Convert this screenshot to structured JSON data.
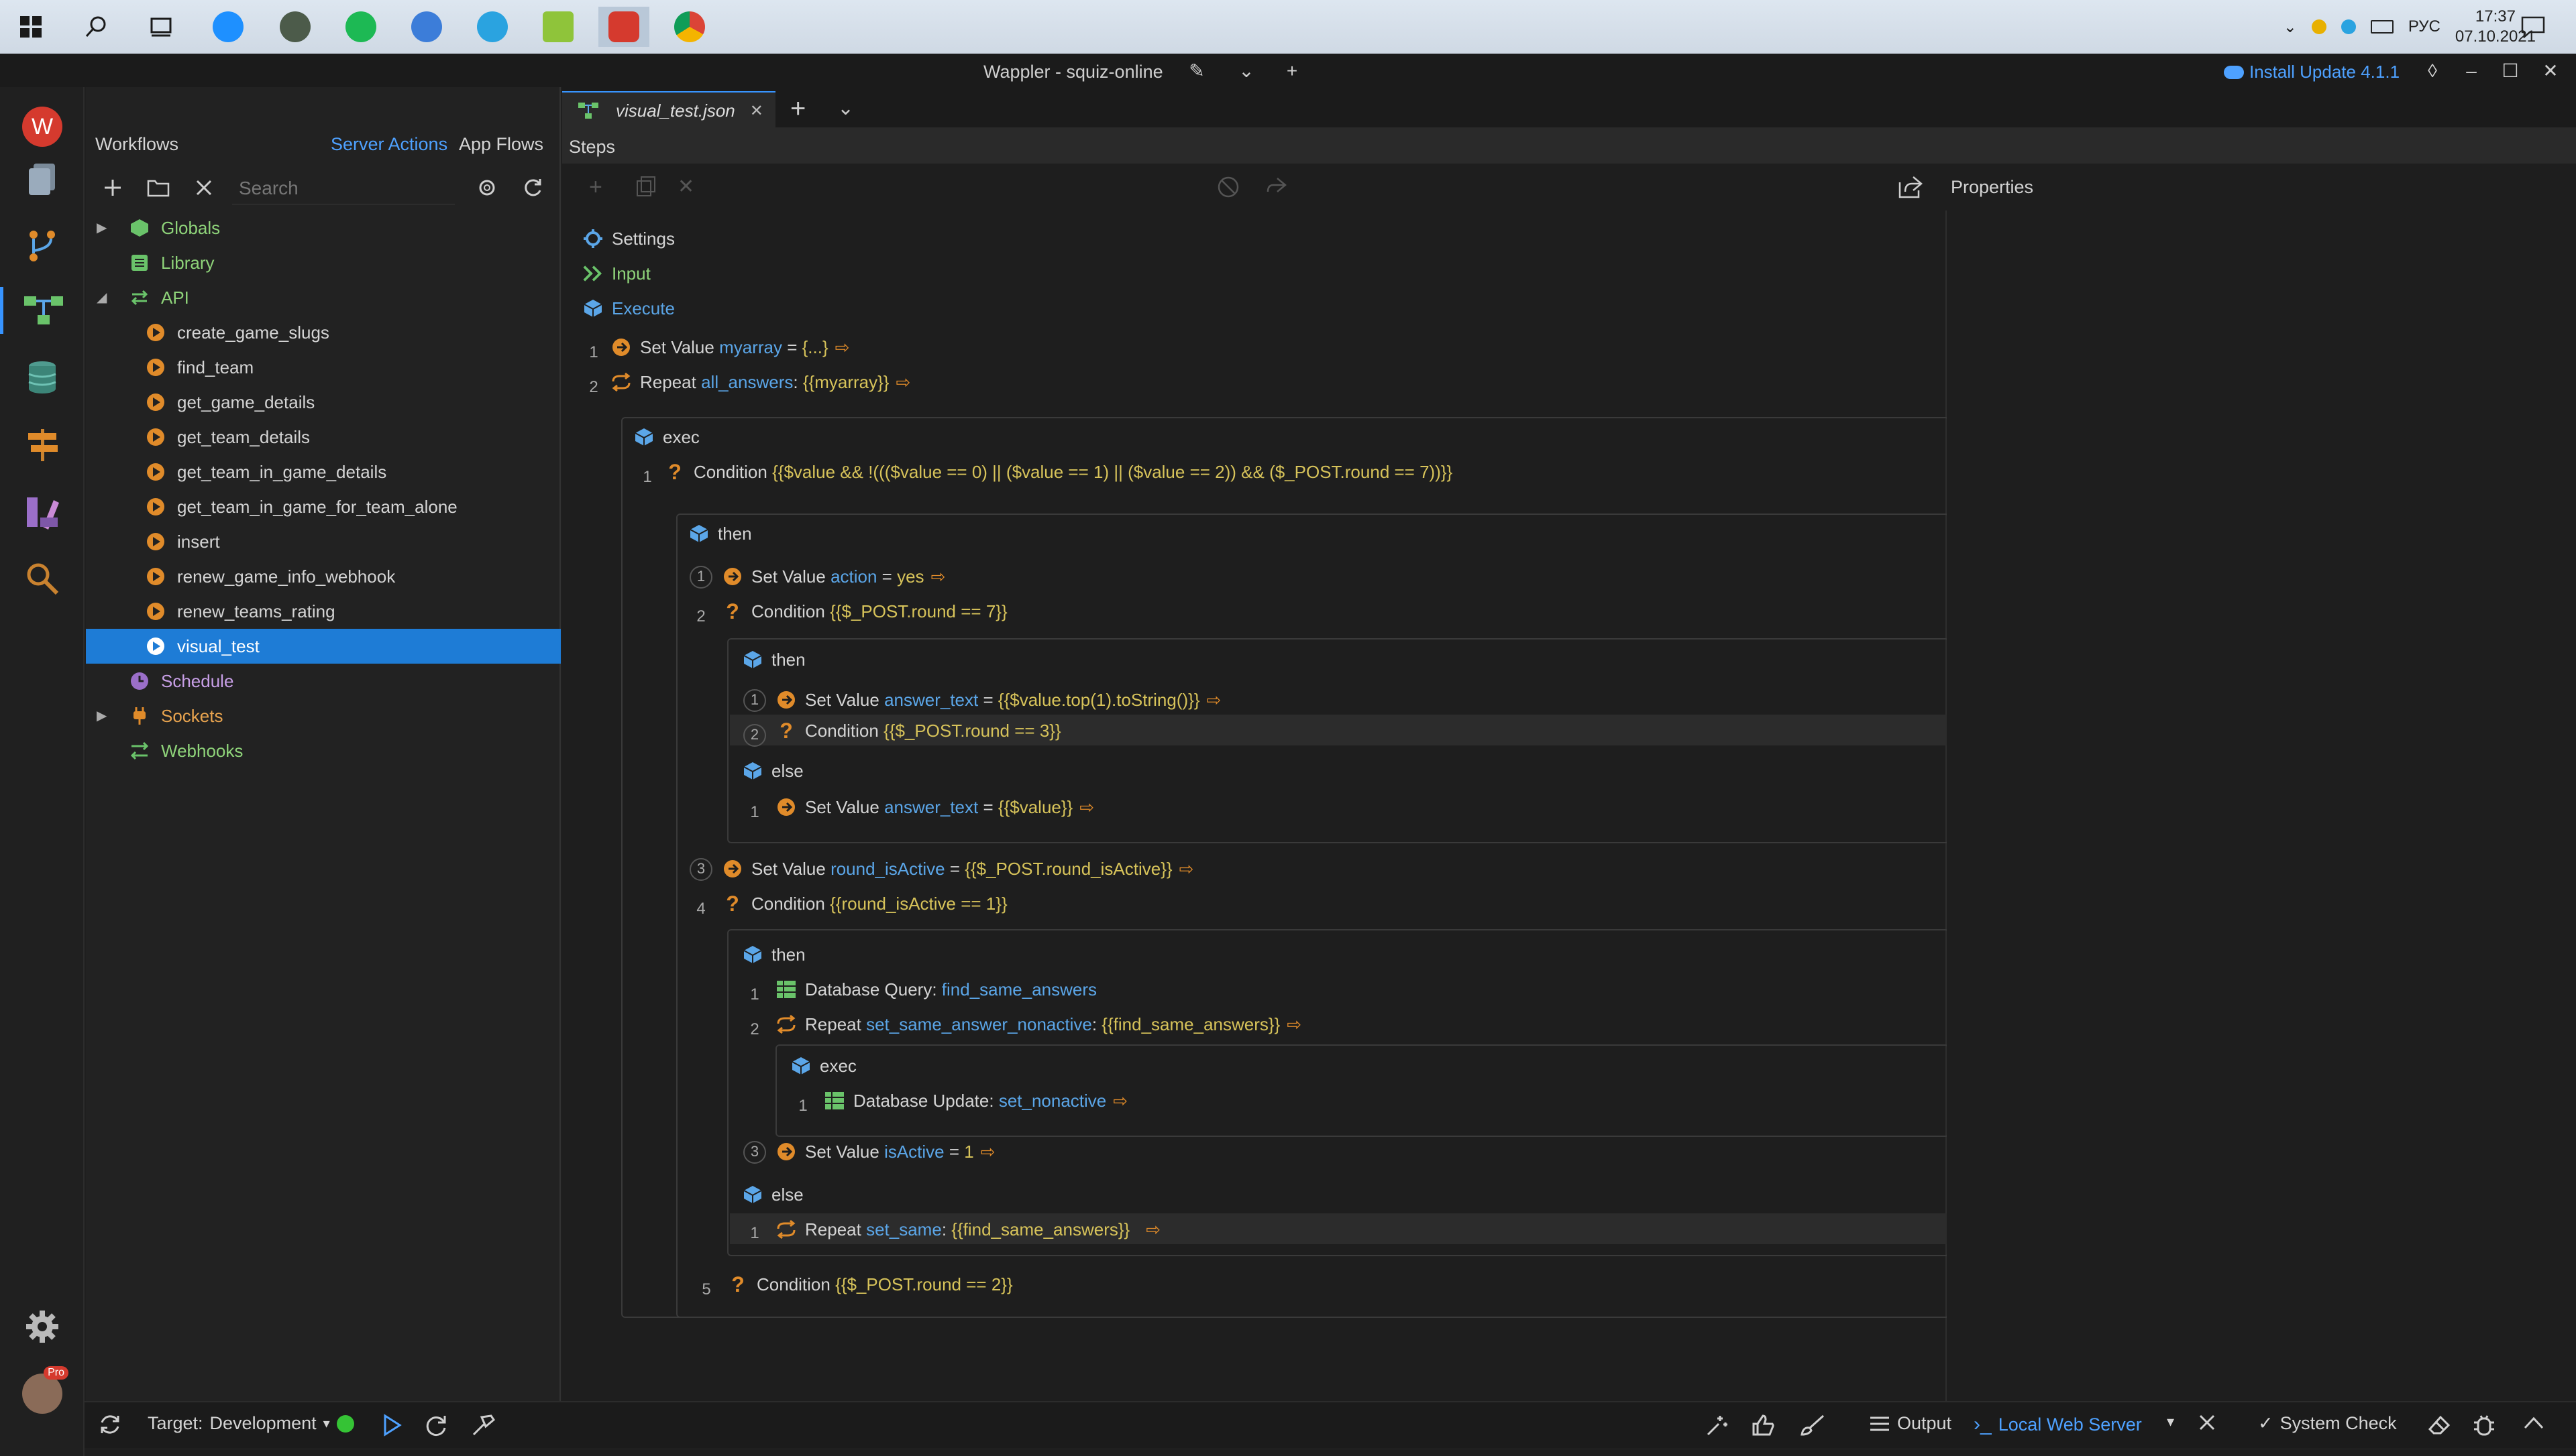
{
  "taskbar": {
    "tray_lang": "РУС",
    "time": "17:37",
    "date": "07.10.2021"
  },
  "window": {
    "title": "Wappler - squiz-online",
    "update_label": "Install Update 4.1.1"
  },
  "workflows": {
    "title": "Workflows",
    "tab_server_actions": "Server Actions",
    "tab_app_flows": "App Flows",
    "search_placeholder": "Search",
    "tree": [
      {
        "label": "Globals"
      },
      {
        "label": "Library"
      },
      {
        "label": "API"
      },
      {
        "label": "create_game_slugs"
      },
      {
        "label": "find_team"
      },
      {
        "label": "get_game_details"
      },
      {
        "label": "get_team_details"
      },
      {
        "label": "get_team_in_game_details"
      },
      {
        "label": "get_team_in_game_for_team_alone"
      },
      {
        "label": "insert"
      },
      {
        "label": "renew_game_info_webhook"
      },
      {
        "label": "renew_teams_rating"
      },
      {
        "label": "visual_test"
      },
      {
        "label": "Schedule"
      },
      {
        "label": "Sockets"
      },
      {
        "label": "Webhooks"
      }
    ]
  },
  "editor": {
    "file_tab": "visual_test.json",
    "steps_label": "Steps",
    "properties_label": "Properties",
    "sections": {
      "settings": "Settings",
      "input": "Input",
      "execute": "Execute"
    },
    "lines": {
      "l1": {
        "num": "1",
        "kw": "Set Value",
        "var": "myarray",
        "op": " = ",
        "val": "{...}"
      },
      "l2": {
        "num": "2",
        "kw": "Repeat",
        "var": "all_answers",
        "op": ": ",
        "val": "{{myarray}}"
      },
      "exec1": "exec",
      "c1": {
        "num": "1",
        "kw": "Condition",
        "val": "{{$value && !((($value == 0) || ($value == 1) || ($value == 2)) && ($_POST.round == 7))}}"
      },
      "then1": "then",
      "t1": {
        "num": "1",
        "kw": "Set Value",
        "var": "action",
        "op": " = ",
        "val": "yes"
      },
      "t2": {
        "num": "2",
        "kw": "Condition",
        "val": "{{$_POST.round == 7}}"
      },
      "then2": "then",
      "t2a": {
        "num": "1",
        "kw": "Set Value",
        "var": "answer_text",
        "op": " = ",
        "val": "{{$value.top(1).toString()}}"
      },
      "t2b": {
        "num": "2",
        "kw": "Condition",
        "val": "{{$_POST.round == 3}}"
      },
      "else2": "else",
      "e2a": {
        "num": "1",
        "kw": "Set Value",
        "var": "answer_text",
        "op": " = ",
        "val": "{{$value}}"
      },
      "t3": {
        "num": "3",
        "kw": "Set Value",
        "var": "round_isActive",
        "op": " = ",
        "val": "{{$_POST.round_isActive}}"
      },
      "t4": {
        "num": "4",
        "kw": "Condition",
        "val": "{{round_isActive == 1}}"
      },
      "then4": "then",
      "t4a": {
        "num": "1",
        "kw": "Database Query:",
        "var": "find_same_answers"
      },
      "t4b": {
        "num": "2",
        "kw": "Repeat",
        "var": "set_same_answer_nonactive",
        "op": ": ",
        "val": "{{find_same_answers}}"
      },
      "exec4": "exec",
      "t4b1": {
        "num": "1",
        "kw": "Database Update:",
        "var": "set_nonactive"
      },
      "t4c": {
        "num": "3",
        "kw": "Set Value",
        "var": "isActive",
        "op": " = ",
        "val": "1"
      },
      "else4": "else",
      "e4a": {
        "num": "1",
        "kw": "Repeat",
        "var": "set_same",
        "op": ": ",
        "val": "{{find_same_answers}}"
      },
      "t5": {
        "num": "5",
        "kw": "Condition",
        "val": "{{$_POST.round == 2}}"
      }
    }
  },
  "statusbar": {
    "target_label": "Target:",
    "target_value": "Development",
    "output": "Output",
    "server": "Local Web Server",
    "system_check": "System Check",
    "pro_badge": "Pro"
  },
  "colors": {
    "accent": "#1e7cd6",
    "variable": "#5ba6e8",
    "value": "#d7c35a",
    "step_icon": "#e08b2a"
  }
}
